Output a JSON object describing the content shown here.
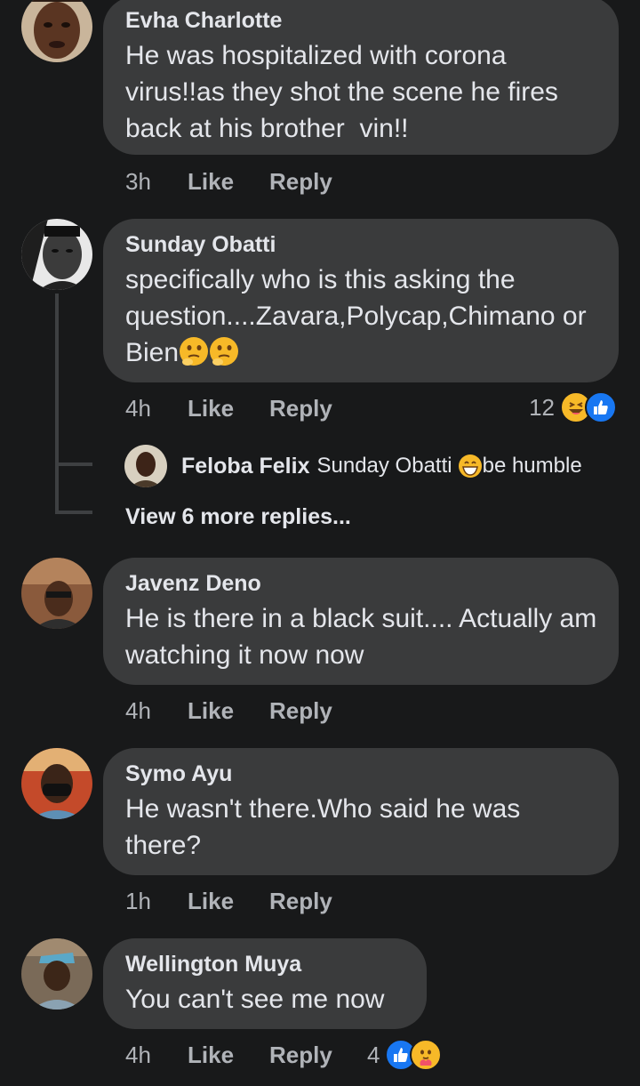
{
  "comments": [
    {
      "author": "Evha Charlotte",
      "text": "He was hospitalized with corona virus!!as they shot the scene he fires back at his brother  vin!!",
      "time": "3h",
      "like": "Like",
      "reply": "Reply"
    },
    {
      "author": "Sunday Obatti",
      "text": "specifically who is this asking the question....Zavara,Polycap,Chimano or Bien",
      "time": "4h",
      "like": "Like",
      "reply": "Reply",
      "reaction_count": "12",
      "reaction_icons": [
        "laugh-emoji",
        "thumbs-up-icon"
      ]
    },
    {
      "author": "Javenz Deno",
      "text": "He is there in a black suit.... Actually am watching it now now",
      "time": "4h",
      "like": "Like",
      "reply": "Reply"
    },
    {
      "author": "Symo Ayu",
      "text": "He wasn't there.Who said he was there?",
      "time": "1h",
      "like": "Like",
      "reply": "Reply"
    },
    {
      "author": "Wellington Muya",
      "text": "You can't see me now",
      "time": "4h",
      "like": "Like",
      "reply": "Reply",
      "reaction_count": "4",
      "reaction_icons": [
        "thumbs-up-icon",
        "care-emoji"
      ]
    }
  ],
  "reply_preview": {
    "author": "Feloba Felix",
    "mention": "Sunday Obatti",
    "text": "be humble"
  },
  "view_more": "View 6 more replies...",
  "colors": {
    "background": "#18191a",
    "bubble": "#3a3b3c",
    "text_primary": "#e4e6eb",
    "text_secondary": "#b0b3b8",
    "like_blue": "#1877f2",
    "emoji_yellow": "#f7b928"
  }
}
